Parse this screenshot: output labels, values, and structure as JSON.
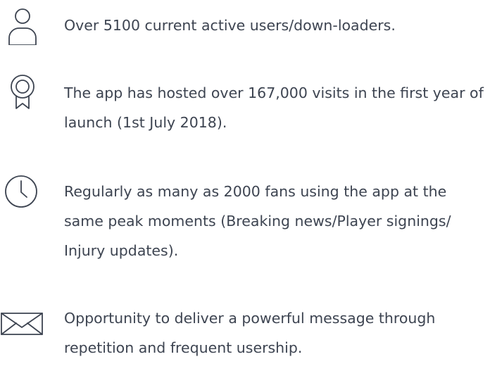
{
  "features": {
    "items": [
      {
        "icon": "user-icon",
        "text": "Over 5100 current active users/down-loaders."
      },
      {
        "icon": "award-ribbon-icon",
        "text": "The app has hosted over 167,000 visits in the first year of launch (1st July 2018)."
      },
      {
        "icon": "clock-icon",
        "text": "Regularly as many as 2000 fans using the app at the same peak moments (Breaking news/Player signings/ Injury updates)."
      },
      {
        "icon": "envelope-icon",
        "text": "Opportunity to deliver a powerful message through repetition and frequent usership."
      }
    ]
  },
  "colors": {
    "text": "#3d4451",
    "icon_stroke": "#3d4451",
    "background": "#ffffff"
  }
}
